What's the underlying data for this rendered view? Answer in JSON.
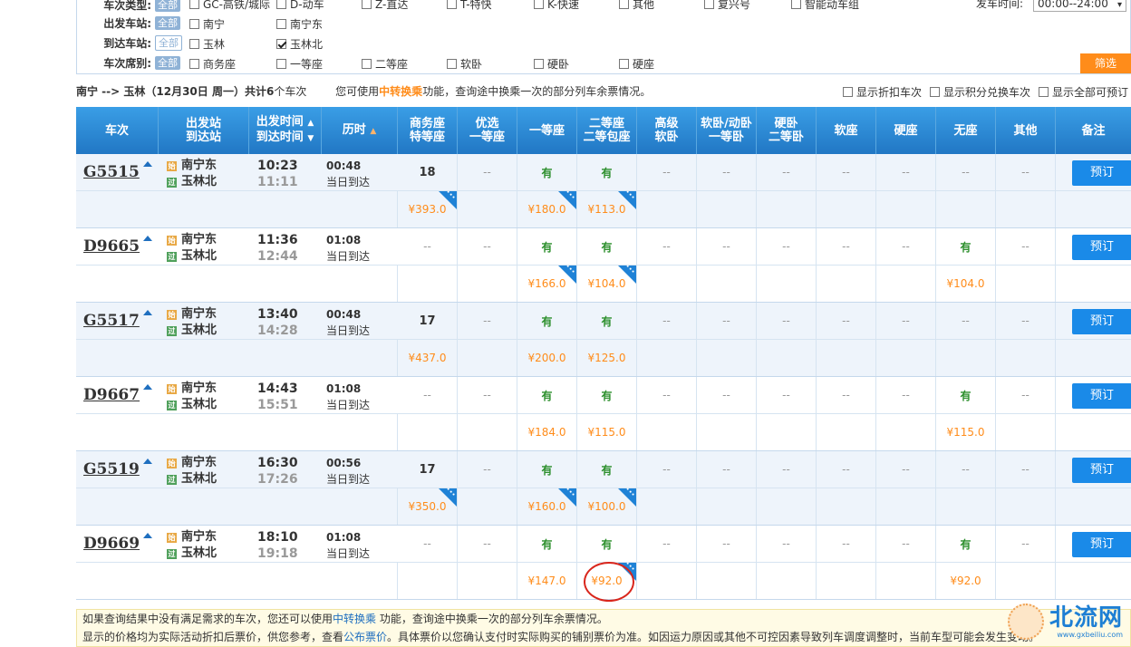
{
  "filters": {
    "type_label": "车次类型:",
    "from_label": "出发车站:",
    "to_label": "到达车站:",
    "seat_label": "车次席别:",
    "all": "全部",
    "types": [
      {
        "label": "GC-高铁/城际",
        "checked": false
      },
      {
        "label": "D-动车",
        "checked": false
      },
      {
        "label": "Z-直达",
        "checked": false
      },
      {
        "label": "T-特快",
        "checked": false
      },
      {
        "label": "K-快速",
        "checked": false
      },
      {
        "label": "其他",
        "checked": false
      },
      {
        "label": "复兴号",
        "checked": false
      },
      {
        "label": "智能动车组",
        "checked": false
      }
    ],
    "from": [
      {
        "label": "南宁",
        "checked": false
      },
      {
        "label": "南宁东",
        "checked": false
      }
    ],
    "to": [
      {
        "label": "玉林",
        "checked": false
      },
      {
        "label": "玉林北",
        "checked": true
      }
    ],
    "seats": [
      {
        "label": "商务座",
        "checked": false
      },
      {
        "label": "一等座",
        "checked": false
      },
      {
        "label": "二等座",
        "checked": false
      },
      {
        "label": "软卧",
        "checked": false
      },
      {
        "label": "硬卧",
        "checked": false
      },
      {
        "label": "硬座",
        "checked": false
      }
    ],
    "time_label": "发车时间:",
    "time_value": "00:00--24:00",
    "filter_button": "筛选"
  },
  "summary": {
    "route": "南宁 --> 玉林（12月30日  周一）共计",
    "count": "6",
    "count_suffix": "个车次",
    "tip_pre": "您可使用",
    "tip_link": "中转换乘",
    "tip_post": "功能，查询途中换乘一次的部分列车余票情况。",
    "opt1": "显示折扣车次",
    "opt2": "显示积分兑换车次",
    "opt3": "显示全部可预订"
  },
  "header": {
    "train": "车次",
    "stations_1": "出发站",
    "stations_2": "到达站",
    "time_1": "出发时间",
    "time_2": "到达时间",
    "duration": "历时",
    "business_1": "商务座",
    "business_2": "特等座",
    "premium_1": "优选",
    "premium_2": "一等座",
    "first": "一等座",
    "second_1": "二等座",
    "second_2": "二等包座",
    "hsoft_1": "高级",
    "hsoft_2": "软卧",
    "softsleep_1": "软卧/动卧",
    "softsleep_2": "一等卧",
    "hardsleep_1": "硬卧",
    "hardsleep_2": "二等卧",
    "softseat": "软座",
    "hardseat": "硬座",
    "noseat": "无座",
    "other": "其他",
    "remark": "备注"
  },
  "trains": [
    {
      "no": "G5515",
      "from": "南宁东",
      "to": "玉林北",
      "dep": "10:23",
      "arr": "11:11",
      "dur": "00:48",
      "day": "当日到达",
      "avail": [
        "18",
        "--",
        "有",
        "有",
        "--",
        "--",
        "--",
        "--",
        "--",
        "--",
        "--"
      ],
      "prices": [
        "¥393.0",
        "",
        "¥180.0",
        "¥113.0",
        "",
        "",
        "",
        "",
        "",
        "",
        ""
      ],
      "corners": [
        true,
        false,
        true,
        true
      ],
      "book": "预订"
    },
    {
      "no": "D9665",
      "from": "南宁东",
      "to": "玉林北",
      "dep": "11:36",
      "arr": "12:44",
      "dur": "01:08",
      "day": "当日到达",
      "avail": [
        "--",
        "--",
        "有",
        "有",
        "--",
        "--",
        "--",
        "--",
        "--",
        "有",
        "--"
      ],
      "prices": [
        "",
        "",
        "¥166.0",
        "¥104.0",
        "",
        "",
        "",
        "",
        "",
        "¥104.0",
        ""
      ],
      "corners": [
        false,
        false,
        true,
        true
      ],
      "book": "预订"
    },
    {
      "no": "G5517",
      "from": "南宁东",
      "to": "玉林北",
      "dep": "13:40",
      "arr": "14:28",
      "dur": "00:48",
      "day": "当日到达",
      "avail": [
        "17",
        "--",
        "有",
        "有",
        "--",
        "--",
        "--",
        "--",
        "--",
        "--",
        "--"
      ],
      "prices": [
        "¥437.0",
        "",
        "¥200.0",
        "¥125.0",
        "",
        "",
        "",
        "",
        "",
        "",
        ""
      ],
      "corners": [
        false,
        false,
        false,
        false
      ],
      "book": "预订"
    },
    {
      "no": "D9667",
      "from": "南宁东",
      "to": "玉林北",
      "dep": "14:43",
      "arr": "15:51",
      "dur": "01:08",
      "day": "当日到达",
      "avail": [
        "--",
        "--",
        "有",
        "有",
        "--",
        "--",
        "--",
        "--",
        "--",
        "有",
        "--"
      ],
      "prices": [
        "",
        "",
        "¥184.0",
        "¥115.0",
        "",
        "",
        "",
        "",
        "",
        "¥115.0",
        ""
      ],
      "corners": [
        false,
        false,
        false,
        false
      ],
      "book": "预订"
    },
    {
      "no": "G5519",
      "from": "南宁东",
      "to": "玉林北",
      "dep": "16:30",
      "arr": "17:26",
      "dur": "00:56",
      "day": "当日到达",
      "avail": [
        "17",
        "--",
        "有",
        "有",
        "--",
        "--",
        "--",
        "--",
        "--",
        "--",
        "--"
      ],
      "prices": [
        "¥350.0",
        "",
        "¥160.0",
        "¥100.0",
        "",
        "",
        "",
        "",
        "",
        "",
        ""
      ],
      "corners": [
        true,
        false,
        true,
        true
      ],
      "book": "预订"
    },
    {
      "no": "D9669",
      "from": "南宁东",
      "to": "玉林北",
      "dep": "18:10",
      "arr": "19:18",
      "dur": "01:08",
      "day": "当日到达",
      "avail": [
        "--",
        "--",
        "有",
        "有",
        "--",
        "--",
        "--",
        "--",
        "--",
        "有",
        "--"
      ],
      "prices": [
        "",
        "",
        "¥147.0",
        "¥92.0",
        "",
        "",
        "",
        "",
        "",
        "¥92.0",
        ""
      ],
      "corners": [
        false,
        false,
        false,
        true
      ],
      "book": "预订"
    }
  ],
  "station_icons": {
    "start": "始",
    "pass": "过"
  },
  "notice": {
    "line1_pre": "如果查询结果中没有满足需求的车次，您还可以使用",
    "line1_link": "中转换乘",
    "line1_post": "功能，查询途中换乘一次的部分列车余票情况。",
    "line2_pre": "显示的价格均为实际活动折扣后票价，供您参考，查看",
    "line2_link": "公布票价",
    "line2_post": "。具体票价以您确认支付时实际购买的铺别票价为准。如因运力原因或其他不可控因素导致列车调度调整时，当前车型可能会发生变动。"
  },
  "watermark": {
    "title": "北流网",
    "url": "www.gxbeiliu.com"
  },
  "colors": {
    "header_blue": "#2177c4",
    "price_orange": "#ff8c1a",
    "available_green": "#2c8f2c",
    "book_blue": "#1a8ae8"
  }
}
